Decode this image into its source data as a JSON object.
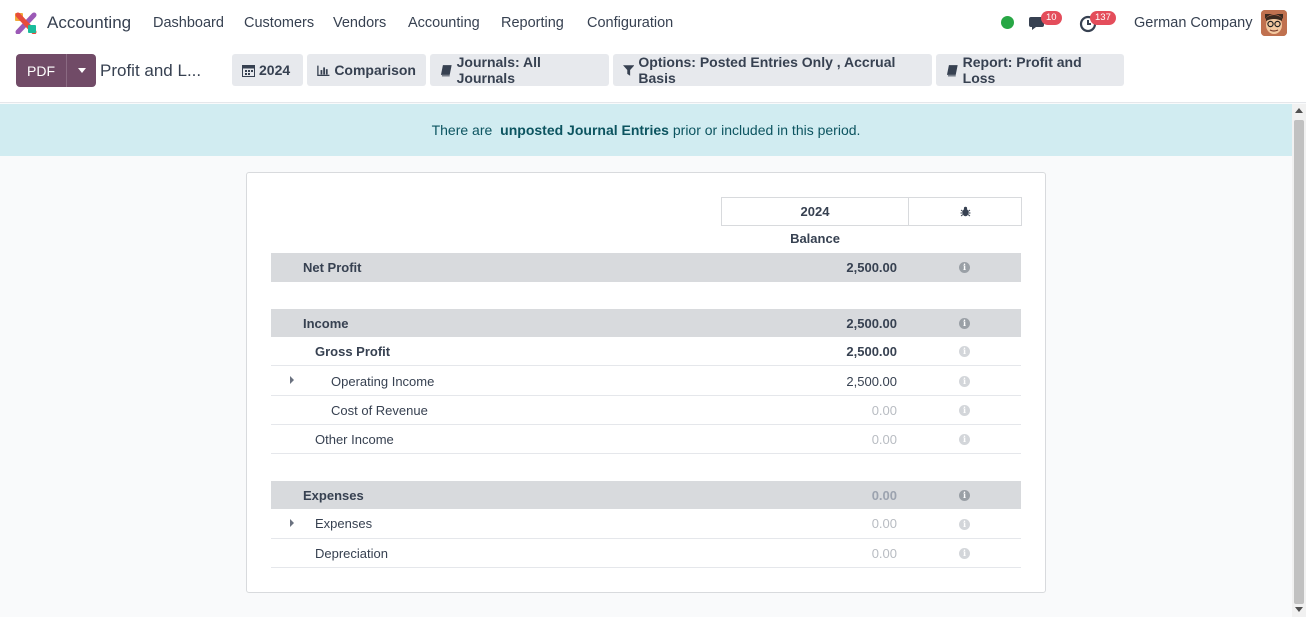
{
  "navbar": {
    "app_name": "Accounting",
    "menu": [
      "Dashboard",
      "Customers",
      "Vendors",
      "Accounting",
      "Reporting",
      "Configuration"
    ],
    "messages_count": "10",
    "activities_count": "137",
    "company": "German Company"
  },
  "control": {
    "pdf_label": "PDF",
    "breadcrumb": "Profit and L...",
    "filters": {
      "period": "2024",
      "comparison": "Comparison",
      "journals": "Journals: All Journals",
      "options": "Options: Posted Entries Only , Accrual Basis",
      "report": "Report: Profit and Loss"
    }
  },
  "alert": {
    "before": "There are ",
    "link": "unposted Journal Entries",
    "after": " prior or included in this period."
  },
  "report": {
    "column_year": "2024",
    "column_label": "Balance",
    "rows": [
      {
        "label": "Net Profit",
        "amount": "2,500.00"
      },
      {
        "label": "Income",
        "amount": "2,500.00"
      },
      {
        "label": "Gross Profit",
        "amount": "2,500.00"
      },
      {
        "label": "Operating Income",
        "amount": "2,500.00"
      },
      {
        "label": "Cost of Revenue",
        "amount": "0.00"
      },
      {
        "label": "Other Income",
        "amount": "0.00"
      },
      {
        "label": "Expenses",
        "amount": "0.00"
      },
      {
        "label": "Expenses",
        "amount": "0.00"
      },
      {
        "label": "Depreciation",
        "amount": "0.00"
      }
    ]
  },
  "colors": {
    "primary": "#714b67",
    "alert_bg": "#d1ecf1",
    "alert_text": "#0c5460",
    "section_bg": "#d8dadd",
    "online_dot": "#28a745",
    "badge": "#e44d5b"
  }
}
